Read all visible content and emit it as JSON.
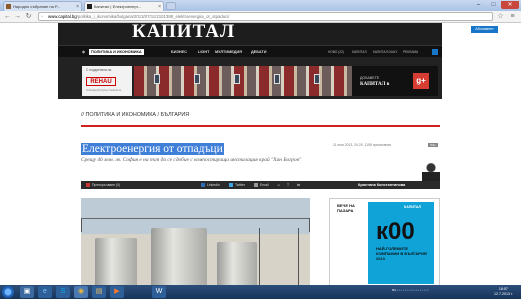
{
  "browser": {
    "tabs": [
      {
        "title": "Народно събрание на Р...",
        "favicon_color": "#8a5a2a"
      },
      {
        "title": "Капитал | Електроенерг...",
        "favicon_color": "#1d1d1d"
      }
    ],
    "address": {
      "host": "www.capital.bg",
      "path": "/politika_i_ikonomika/bulgaria/2013/07/11/2101388_elektroenergiia_ot_otpaduci/"
    },
    "window_controls": [
      "–",
      "□",
      "✕"
    ]
  },
  "site": {
    "logo": "КАПИТАЛ",
    "subscribe_label": "Абонамент",
    "menu": [
      "ПОЛИТИКА И ИКОНОМИКА",
      "БИЗНЕС",
      "LIGHT",
      "МУЛТИМЕДИЯ",
      "ДЕБАТИ"
    ],
    "menu_right": [
      "НОВО (22)",
      "КАПИТАЛ",
      "КАПИТАЛ DAILY",
      "РЕКЛАМА"
    ],
    "banner": {
      "left_small": "С подкрепата на",
      "left_brand": "REHAU",
      "left_sub": "Unlimited Polymer Solutions",
      "right_small": "ДОБАВЕТЕ",
      "right_brand": "КАПИТАЛ в",
      "gplus": "g+"
    }
  },
  "article": {
    "breadcrumb": "// ПОЛИТИКА И ИКОНОМИКА / БЪЛГАРИЯ",
    "title": "Електроенергия от отпадъци",
    "lede": "Срещу 46 млн. лв. София е на път да се сдобие с компостираща инсталация край \"Хан Богров\"",
    "meta": "11 юли 2013, 20:25, 1158 прочитания",
    "meta_badge": "IMG",
    "share": {
      "label": "Препоръчване (0)",
      "linkedin": "LinkedIn",
      "twitter": "Twitter",
      "email": "Email",
      "extras": [
        "☺",
        "T",
        "⇆"
      ]
    },
    "author": "Кристина Константинова"
  },
  "ad": {
    "title": "ВЕЧЕ НА\nПАЗАРА",
    "header": "КАПИТАЛ",
    "big": "к00",
    "caption": "НАЙ-ГОЛЕМИТЕ КОМПАНИИ В БЪЛГАРИЯ 2013"
  },
  "taskbar": {
    "tray_text": "BG",
    "time": "18:57",
    "date": "12.7.2013 г."
  },
  "colors": {
    "accent_red": "#d02020",
    "selection_blue": "#3f7fd8",
    "site_dark": "#1d1d1d",
    "ad_cyan": "#0fa3d8"
  }
}
